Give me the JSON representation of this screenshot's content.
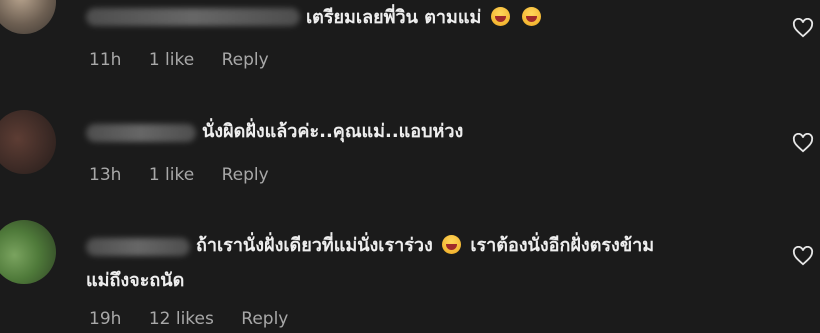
{
  "comments": [
    {
      "text": "เตรียมเลยพี่วิน ตามแม่",
      "emojis": [
        "laughing-emoji",
        "laughing-emoji"
      ],
      "time": "11h",
      "likes": "1 like",
      "reply": "Reply"
    },
    {
      "text": "นั่งผิดฝั่งแล้วค่ะ..คุณแม่..แอบห่วง",
      "time": "13h",
      "likes": "1 like",
      "reply": "Reply"
    },
    {
      "text_part1": "ถ้าเรานั่งฝั่งเดียวที่แม่นั่งเราร่วง",
      "text_part2": "เราต้องนั่งอีกฝั่งตรงข้าม",
      "text_line2": "แม่ถึงจะถนัด",
      "emojis": [
        "laughing-emoji"
      ],
      "time": "19h",
      "likes": "12 likes",
      "reply": "Reply"
    }
  ],
  "colors": {
    "background": "#1b1b1b",
    "text": "#eeeeee",
    "meta": "#a8a8a8"
  },
  "icons": [
    "heart-outline-icon"
  ]
}
